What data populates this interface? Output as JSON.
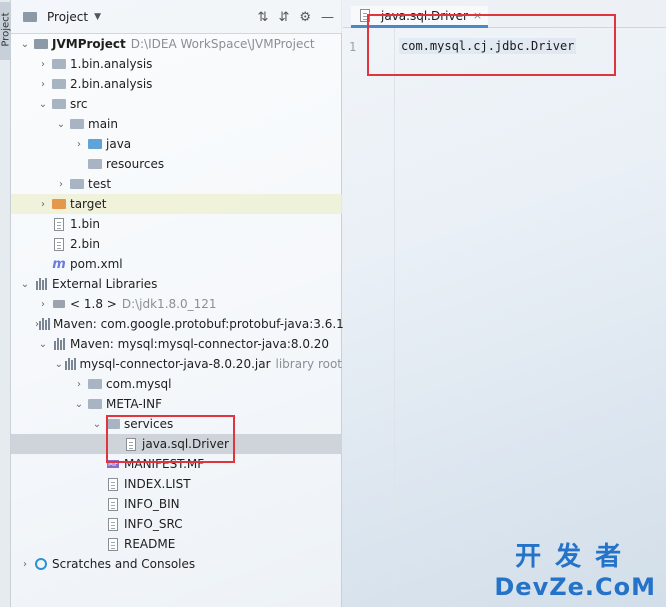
{
  "side_tab": "Project",
  "panel": {
    "title": "Project",
    "icons": [
      "expand-all-icon",
      "collapse-all-icon",
      "gear-icon",
      "minimize-icon"
    ]
  },
  "tree": [
    {
      "indent": 0,
      "arrow": "down",
      "icon": "folder-mod",
      "label": "JVMProject",
      "hint": "D:\\IDEA WorkSpace\\JVMProject",
      "bold": true
    },
    {
      "indent": 1,
      "arrow": "right",
      "icon": "folder",
      "label": "1.bin.analysis"
    },
    {
      "indent": 1,
      "arrow": "right",
      "icon": "folder",
      "label": "2.bin.analysis"
    },
    {
      "indent": 1,
      "arrow": "down",
      "icon": "folder",
      "label": "src"
    },
    {
      "indent": 2,
      "arrow": "down",
      "icon": "folder",
      "label": "main"
    },
    {
      "indent": 3,
      "arrow": "right",
      "icon": "folder-blue",
      "label": "java"
    },
    {
      "indent": 3,
      "arrow": "",
      "icon": "folder",
      "label": "resources"
    },
    {
      "indent": 2,
      "arrow": "right",
      "icon": "folder",
      "label": "test"
    },
    {
      "indent": 1,
      "arrow": "right",
      "icon": "folder-orange",
      "label": "target",
      "highlight": true
    },
    {
      "indent": 1,
      "arrow": "",
      "icon": "file",
      "label": "1.bin"
    },
    {
      "indent": 1,
      "arrow": "",
      "icon": "file",
      "label": "2.bin"
    },
    {
      "indent": 1,
      "arrow": "",
      "icon": "maven",
      "label": "pom.xml"
    },
    {
      "indent": 0,
      "arrow": "down",
      "icon": "library",
      "label": "External Libraries"
    },
    {
      "indent": 1,
      "arrow": "right",
      "icon": "jdk",
      "label": "< 1.8 >",
      "hint": "D:\\jdk1.8.0_121"
    },
    {
      "indent": 1,
      "arrow": "right",
      "icon": "library",
      "label": "Maven: com.google.protobuf:protobuf-java:3.6.1"
    },
    {
      "indent": 1,
      "arrow": "down",
      "icon": "library",
      "label": "Maven: mysql:mysql-connector-java:8.0.20"
    },
    {
      "indent": 2,
      "arrow": "down",
      "icon": "jar",
      "label": "mysql-connector-java-8.0.20.jar",
      "hint": "library root"
    },
    {
      "indent": 3,
      "arrow": "right",
      "icon": "folder",
      "label": "com.mysql"
    },
    {
      "indent": 3,
      "arrow": "down",
      "icon": "folder",
      "label": "META-INF"
    },
    {
      "indent": 4,
      "arrow": "down",
      "icon": "folder",
      "label": "services"
    },
    {
      "indent": 5,
      "arrow": "",
      "icon": "file",
      "label": "java.sql.Driver",
      "selected": true
    },
    {
      "indent": 4,
      "arrow": "",
      "icon": "mf",
      "label": "MANIFEST.MF"
    },
    {
      "indent": 4,
      "arrow": "",
      "icon": "file",
      "label": "INDEX.LIST"
    },
    {
      "indent": 4,
      "arrow": "",
      "icon": "file",
      "label": "INFO_BIN"
    },
    {
      "indent": 4,
      "arrow": "",
      "icon": "file",
      "label": "INFO_SRC"
    },
    {
      "indent": 4,
      "arrow": "",
      "icon": "file",
      "label": "README"
    },
    {
      "indent": 0,
      "arrow": "right",
      "icon": "scratch",
      "label": "Scratches and Consoles"
    }
  ],
  "editor": {
    "tab_label": "java.sql.Driver",
    "tab_close": "×",
    "line_number": "1",
    "code": "com.mysql.cj.jdbc.Driver"
  },
  "watermark": {
    "line1": "开发者",
    "line2": "DevZe.CoM"
  },
  "colors": {
    "highlight_box": "#e0343e",
    "selection": "#cfd4da",
    "watermark": "#2473c9"
  }
}
